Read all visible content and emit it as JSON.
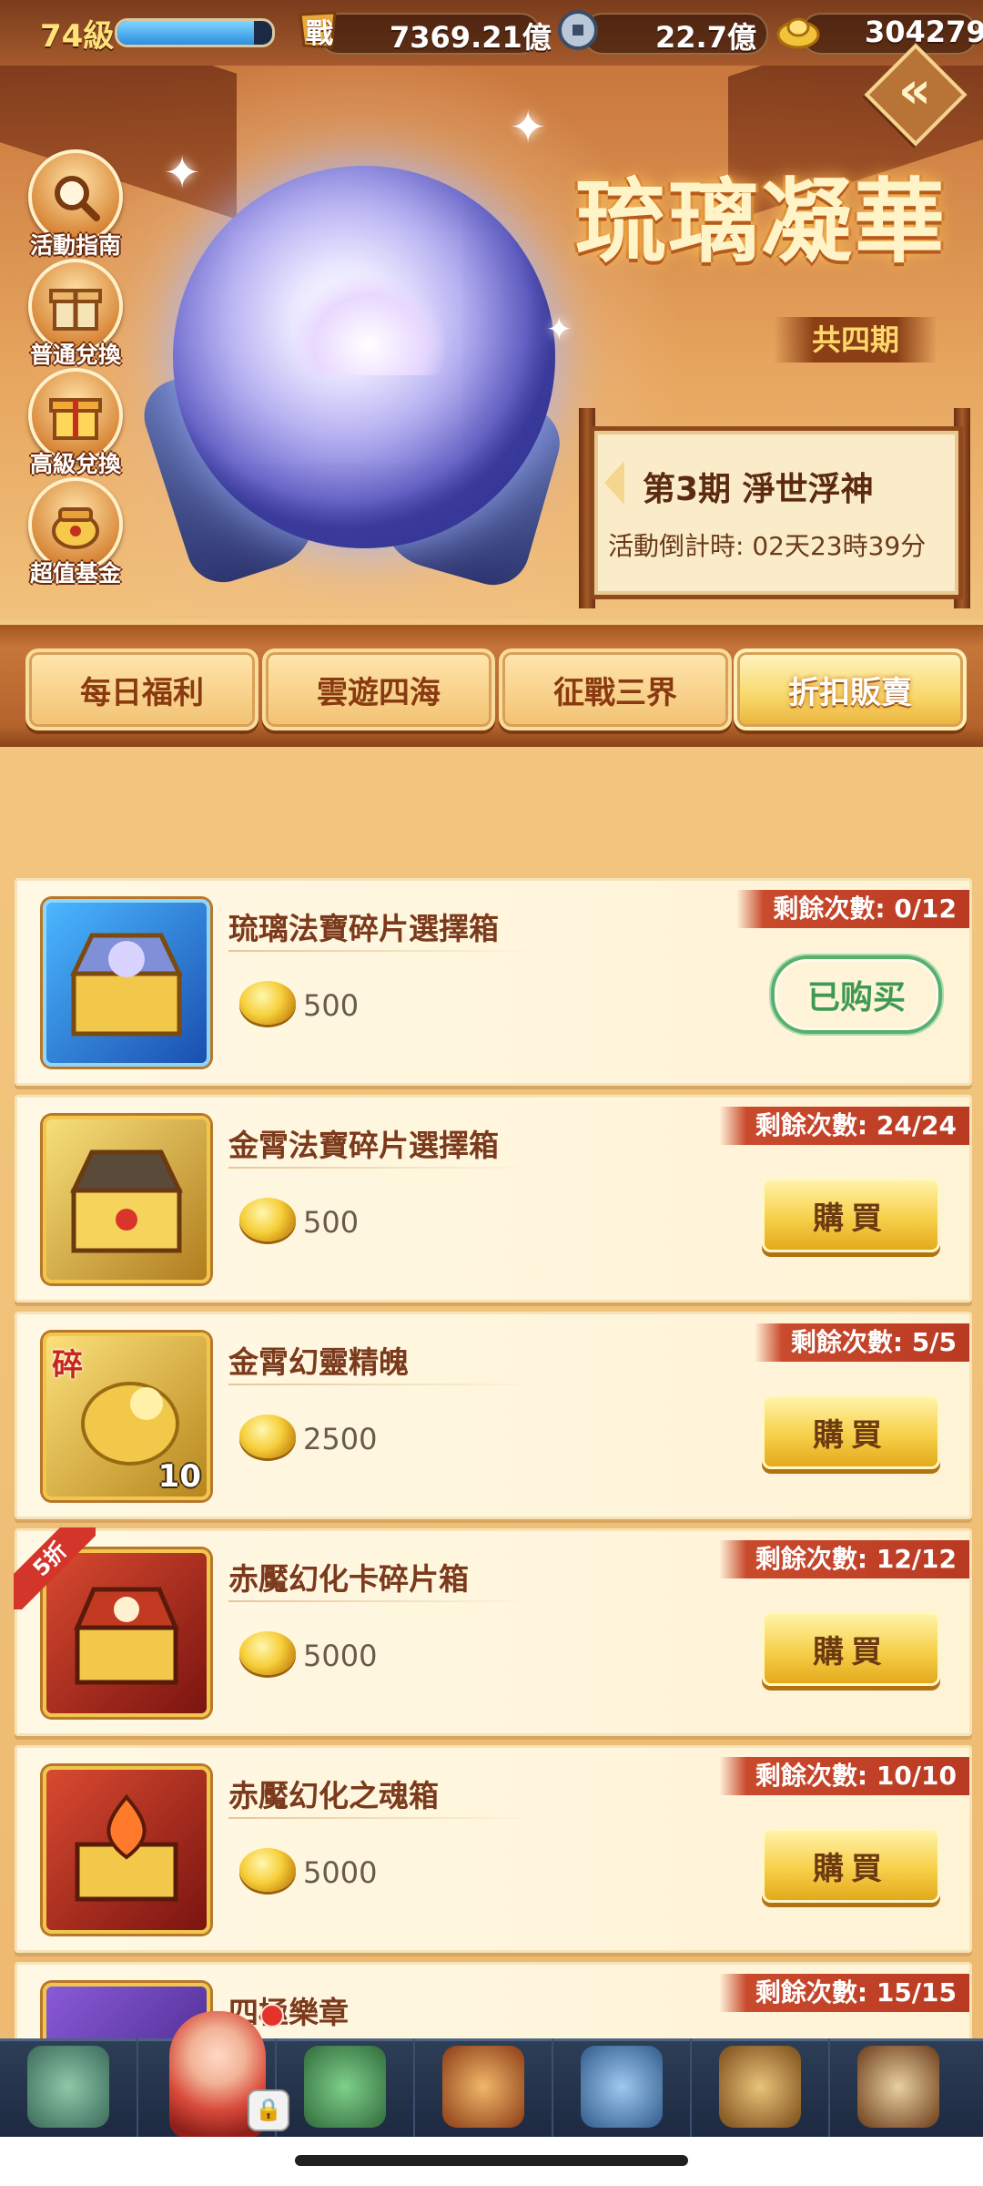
{
  "topbar": {
    "level": "74級",
    "exp_progress": 0.88,
    "power_icon_text": "戰",
    "power_value": "7369.21億",
    "coin_value": "22.7億",
    "gold_value": "304279"
  },
  "banner": {
    "title": "琉璃凝華",
    "subtitle": "共四期",
    "period": "第3期  淨世浮神",
    "countdown": "活動倒計時: 02天23時39分",
    "side_buttons": [
      {
        "label": "活動指南",
        "icon": "magnifier-icon"
      },
      {
        "label": "普通兌換",
        "icon": "gift-box-icon"
      },
      {
        "label": "高級兌換",
        "icon": "gift-box-gold-icon"
      },
      {
        "label": "超值基金",
        "icon": "treasure-pot-icon"
      }
    ]
  },
  "tabs": [
    {
      "label": "每日福利",
      "active": false
    },
    {
      "label": "雲遊四海",
      "active": false
    },
    {
      "label": "征戰三界",
      "active": false
    },
    {
      "label": "折扣販賣",
      "active": true
    }
  ],
  "items": [
    {
      "name": "琉璃法寶碎片選擇箱",
      "price": "500",
      "remaining": "剩餘次數: 0/12",
      "button": "已购买",
      "bought": true
    },
    {
      "name": "金霄法寶碎片選擇箱",
      "price": "500",
      "remaining": "剩餘次數: 24/24",
      "button": "購買",
      "bought": false
    },
    {
      "name": "金霄幻靈精魄",
      "price": "2500",
      "remaining": "剩餘次數: 5/5",
      "button": "購買",
      "bought": false,
      "badge": "碎",
      "count": "10"
    },
    {
      "name": "赤魘幻化卡碎片箱",
      "price": "5000",
      "remaining": "剩餘次數: 12/12",
      "button": "購買",
      "bought": false,
      "discount": "5折"
    },
    {
      "name": "赤魘幻化之魂箱",
      "price": "5000",
      "remaining": "剩餘次數: 10/10",
      "button": "購買",
      "bought": false
    },
    {
      "name": "四極樂章",
      "remaining": "剩餘次數: 15/15"
    }
  ],
  "colors": {
    "accent_gold": "#f7d04a",
    "remaining_red": "#c94a2d",
    "bought_green": "#3e9a53",
    "name_brown": "#7b3a1c"
  }
}
